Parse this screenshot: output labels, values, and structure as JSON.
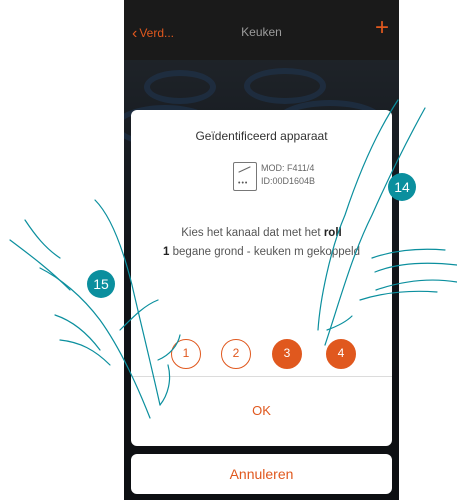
{
  "header": {
    "back_label": "Verd...",
    "title": "Keuken",
    "add_symbol": "+"
  },
  "dialog": {
    "title": "Geïdentificeerd apparaat",
    "device_mod": "MOD: F411/4",
    "device_id": "ID:00D1604B",
    "instruction_prefix": "Kies het kanaal dat met het ",
    "instruction_bold1": "roll",
    "instruction_mid": "",
    "instruction_bold2": "1",
    "instruction_suffix": " begane grond - keuken m gekoppeld",
    "channels": [
      "1",
      "2",
      "3",
      "4"
    ],
    "selected_channels": [
      "3",
      "4"
    ],
    "ok_label": "OK"
  },
  "cancel_label": "Annuleren",
  "step_badges": [
    "14",
    "15"
  ],
  "colors": {
    "accent": "#e0581e",
    "badge": "#0b8f9e",
    "topbar": "#1a1a1a"
  }
}
